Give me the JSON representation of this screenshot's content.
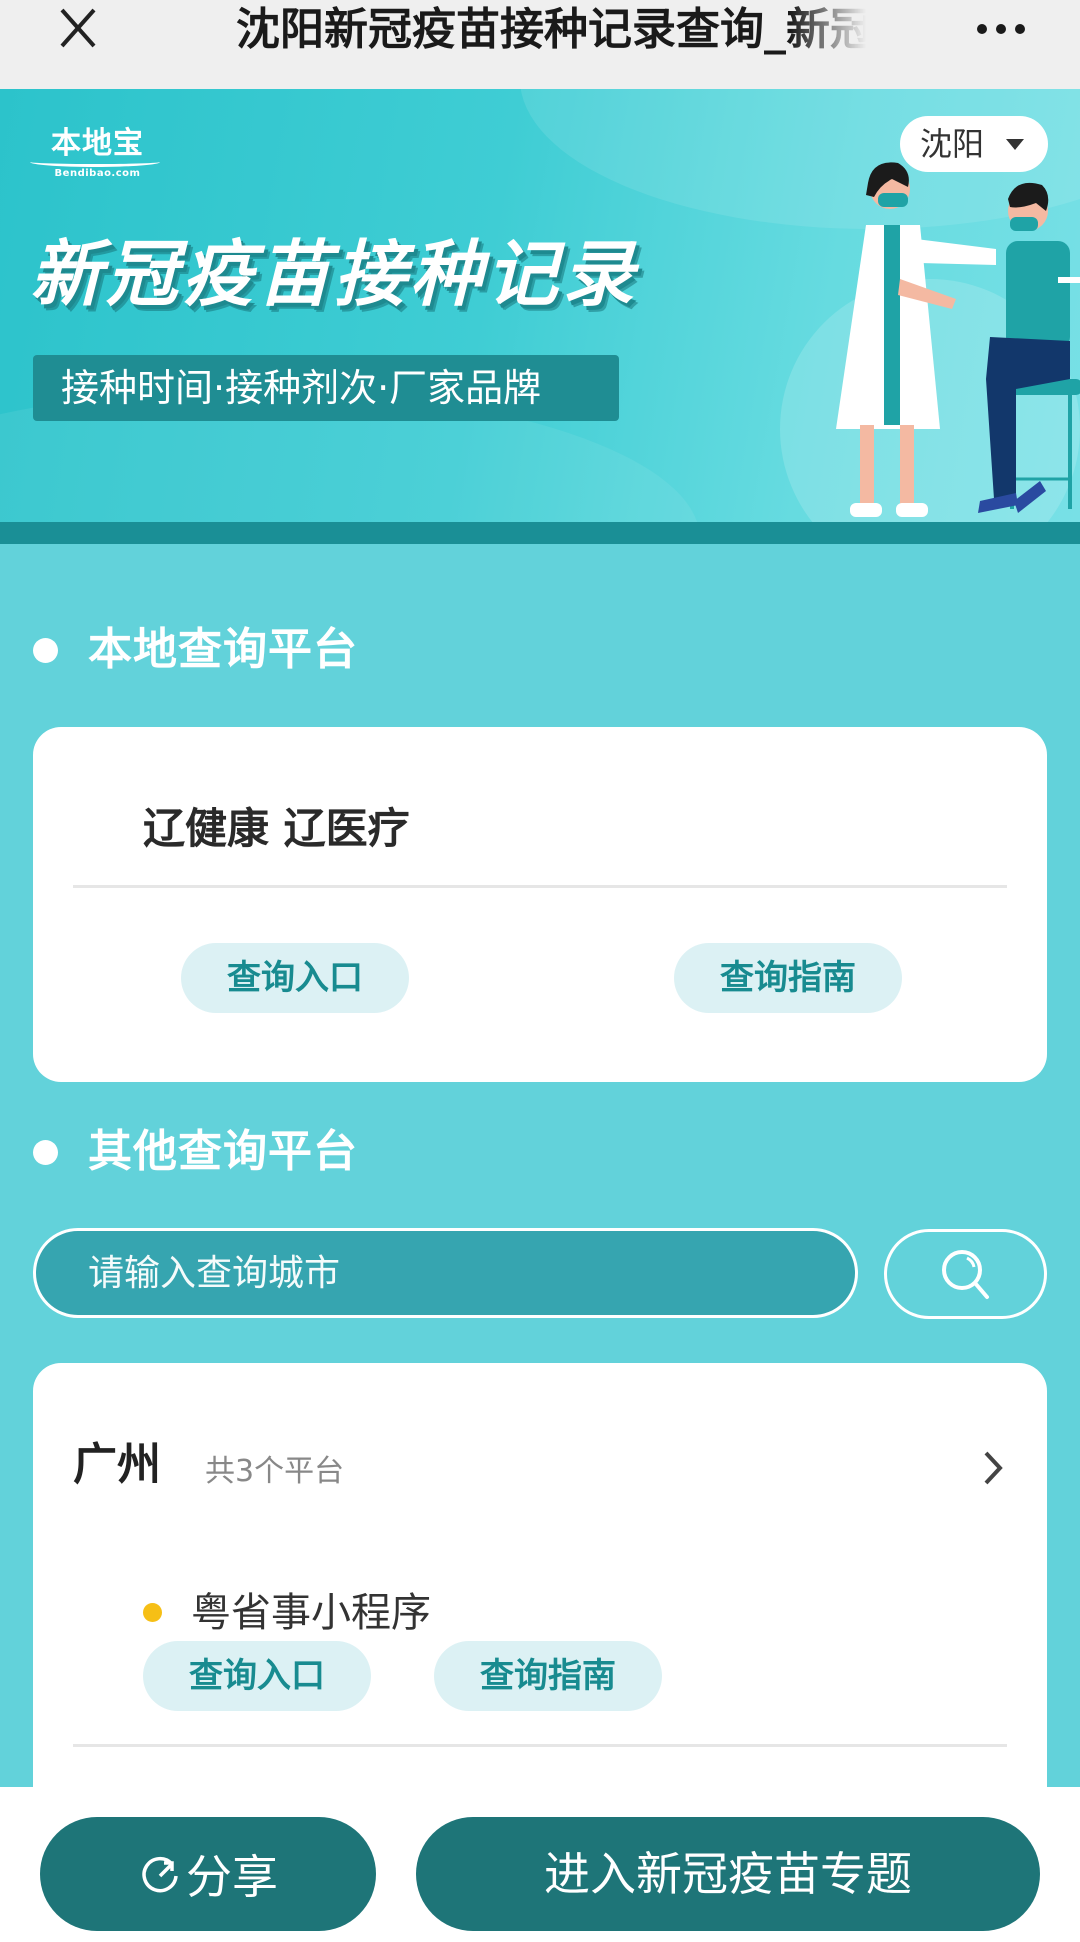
{
  "topbar": {
    "title": "沈阳新冠疫苗接种记录查询_新冠疫苗接种记录",
    "close_icon": "close-icon",
    "more_icon": "more-dots-icon"
  },
  "banner": {
    "logo_cn": "本地宝",
    "logo_en": "Bendibao.com",
    "title": "新冠疫苗接种记录",
    "subtitle": "接种时间·接种剂次·厂家品牌",
    "city_selector": "沈阳",
    "illustration": "doctor-vaccinating-patient"
  },
  "local_section": {
    "heading": "本地查询平台",
    "card": {
      "platform_name": "辽健康 辽医疗",
      "entry_label": "查询入口",
      "guide_label": "查询指南"
    }
  },
  "other_section": {
    "heading": "其他查询平台",
    "search": {
      "value": "",
      "placeholder": "请输入查询城市",
      "button_icon": "search-icon"
    },
    "cities": [
      {
        "name": "广州",
        "count_text": "共3个平台",
        "platforms": [
          {
            "name": "粤省事小程序",
            "entry_label": "查询入口",
            "guide_label": "查询指南"
          }
        ]
      }
    ]
  },
  "bottombar": {
    "share_label": "分享",
    "topic_label": "进入新冠疫苗专题"
  },
  "colors": {
    "page_bg": "#62d2da",
    "accent_dark": "#1e7578",
    "pill_bg": "#dcf1f4",
    "pill_text": "#188b90",
    "bullet": "#f6bf16"
  }
}
